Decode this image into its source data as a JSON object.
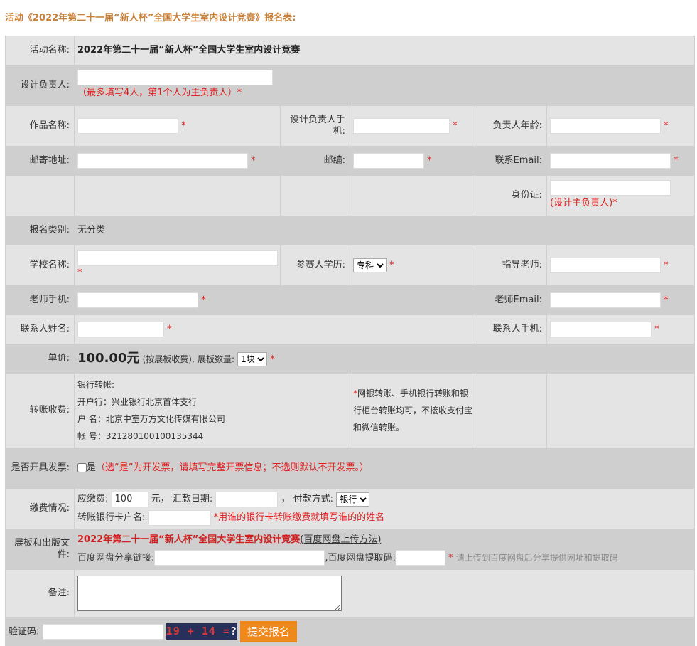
{
  "heading": "活动《2022年第二十一届“新人杯”全国大学生室内设计竞赛》报名表:",
  "required_mark": "*",
  "activity": {
    "label": "活动名称:",
    "value": "2022年第二十一届“新人杯”全国大学生室内设计竞赛"
  },
  "designer": {
    "label": "设计负责人:",
    "note": "（最多填写4人，第1个人为主负责人）*"
  },
  "work_name": {
    "label": "作品名称:"
  },
  "designer_phone": {
    "label": "设计负责人手机:"
  },
  "designer_age": {
    "label": "负责人年龄:"
  },
  "address": {
    "label": "邮寄地址:"
  },
  "zip": {
    "label": "邮编:"
  },
  "email": {
    "label": "联系Email:"
  },
  "id_card": {
    "label": "身份证:",
    "note": "(设计主负责人)*"
  },
  "category": {
    "label": "报名类别:",
    "value": "无分类"
  },
  "school": {
    "label": "学校名称:"
  },
  "education": {
    "label": "参赛人学历:",
    "selected": "专科"
  },
  "teacher": {
    "label": "指导老师:"
  },
  "teacher_phone": {
    "label": "老师手机:"
  },
  "teacher_email": {
    "label": "老师Email:"
  },
  "contact_name": {
    "label": "联系人姓名:"
  },
  "contact_phone": {
    "label": "联系人手机:"
  },
  "price": {
    "label": "单价:",
    "value": "100.00元",
    "note": "(按展板收费),",
    "board_label": "展板数量:",
    "board_selected": "1块"
  },
  "transfer": {
    "label": "转账收费:",
    "bank_title": "银行转帐:",
    "bank_line1": "开户行：兴业银行北京首体支行",
    "bank_line2": "户 名：北京中室万方文化传媒有限公司",
    "bank_line3": "帐 号：321280100100135344",
    "note_mark": "*",
    "note": "网银转账、手机银行转账和银行柜台转账均可，不接收支付宝和微信转账。"
  },
  "invoice": {
    "label": "是否开具发票:",
    "checkbox_label": "是",
    "note": "（选“是”为开发票，请填写完整开票信息；不选则默认不开发票。）"
  },
  "payment": {
    "label": "缴费情况:",
    "amount_label": "应缴费:",
    "amount_value": "100",
    "unit": "元，",
    "date_label": "汇款日期:",
    "comma": "，",
    "method_label": "付款方式:",
    "method_selected": "银行",
    "card_label": "转账银行卡户名:",
    "card_note": "*用谁的银行卡转账缴费就填写谁的的姓名"
  },
  "files": {
    "label": "展板和出版文件:",
    "activity_link": "2022年第二十一届“新人杯”全国大学生室内设计竞赛",
    "upload_link": "(百度网盘上传方法)",
    "share_label": "百度网盘分享链接:",
    "code_label": ",百度网盘提取码:",
    "tip": "请上传到百度网盘后分享提供网址和提取码"
  },
  "remark": {
    "label": "备注:"
  },
  "captcha": {
    "label": "验证码:",
    "text": "19 + 14 =",
    "question": "?"
  },
  "submit": {
    "label": "提交报名"
  }
}
